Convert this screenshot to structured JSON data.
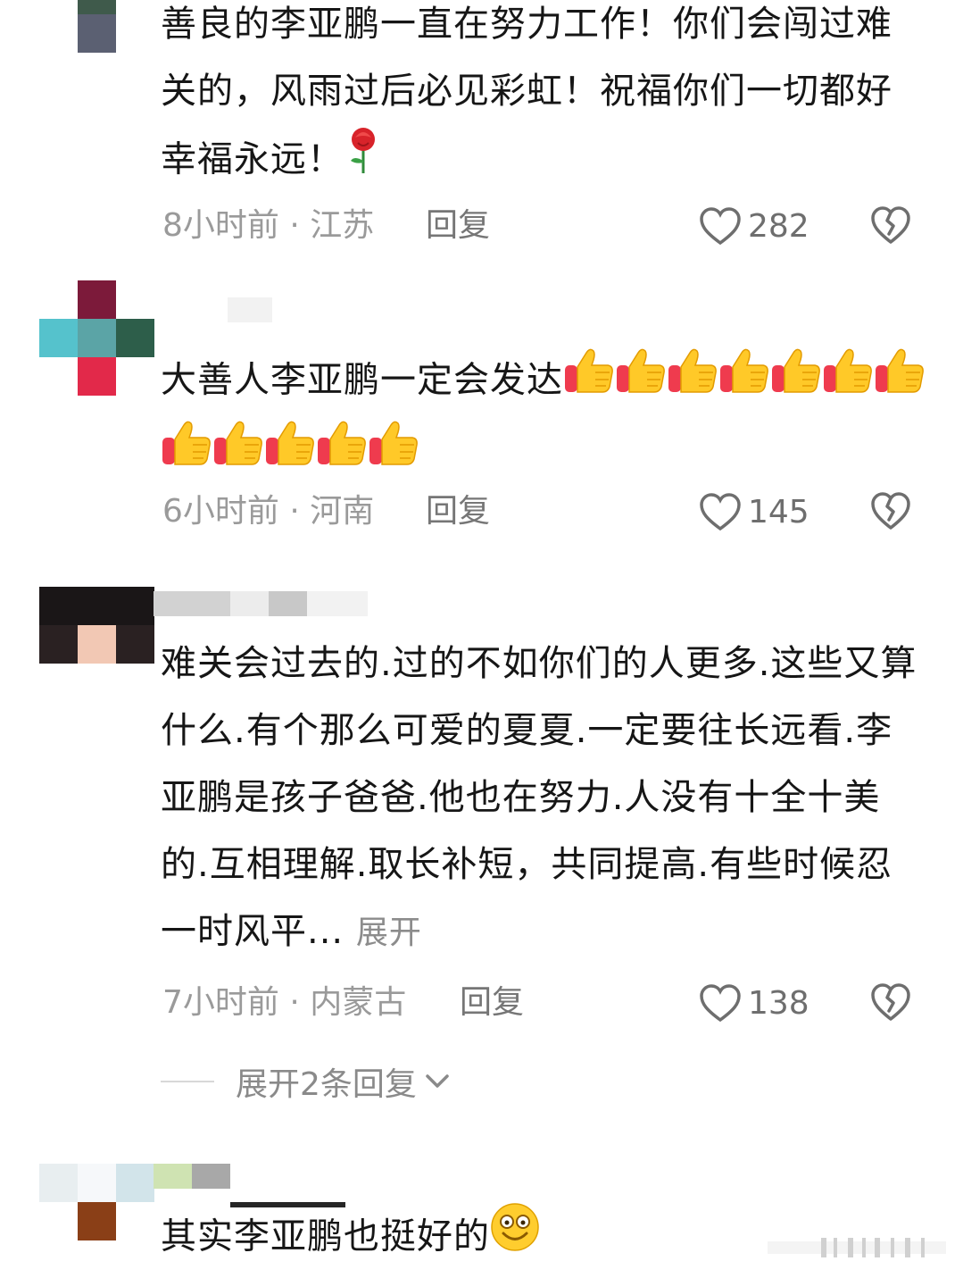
{
  "comments": [
    {
      "text": "善良的李亚鹏一直在努力工作！你们会闯过难关的，风雨过后必见彩虹！祝福你们一切都好幸福永远！",
      "emoji": "rose",
      "time_location": "8小时前 · 江苏",
      "reply_label": "回复",
      "likes": "282"
    },
    {
      "text": "大善人李亚鹏一定会发达",
      "emoji": "thumbs-up",
      "emoji_count": 12,
      "time_location": "6小时前 · 河南",
      "reply_label": "回复",
      "likes": "145"
    },
    {
      "text": "难关会过去的.过的不如你们的人更多.这些又算什么.有个那么可爱的夏夏.一定要往长远看.李亚鹏是孩子爸爸.他也在努力.人没有十全十美的.互相理解.取长补短，共同提高.有些时候忍一时风平...",
      "expand_label": "展开",
      "time_location": "7小时前 · 内蒙古",
      "reply_label": "回复",
      "likes": "138",
      "thread_label": "展开2条回复"
    },
    {
      "text": "其实李亚鹏也挺好的",
      "emoji": "smiling-face"
    }
  ],
  "colors": {
    "text": "#161616",
    "meta": "#9a9a9a",
    "icon": "#6e6e6e"
  }
}
